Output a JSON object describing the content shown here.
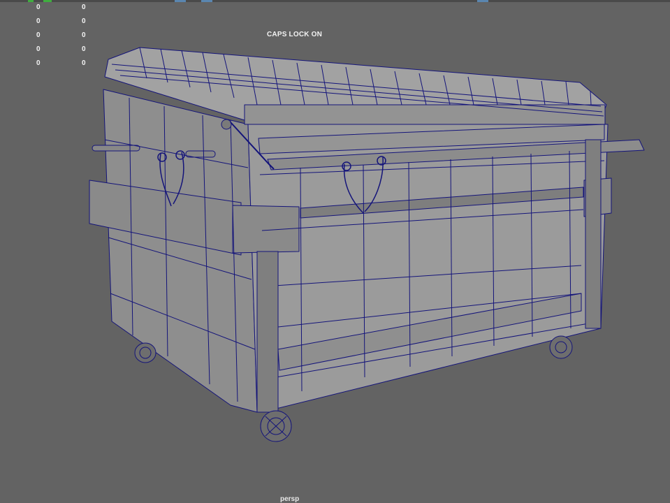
{
  "hud": {
    "rows": [
      {
        "a": "0",
        "b": "0"
      },
      {
        "a": "0",
        "b": "0"
      },
      {
        "a": "0",
        "b": "0"
      },
      {
        "a": "0",
        "b": "0"
      },
      {
        "a": "0",
        "b": "0"
      }
    ]
  },
  "status": {
    "caps_lock": "CAPS LOCK ON"
  },
  "viewport": {
    "camera": "persp"
  },
  "colors": {
    "background": "#636363",
    "wireframe": "#14147a",
    "surface": "#9a9a9a",
    "surface_dark": "#848484"
  },
  "scene": {
    "object": "dumpster wireframe model"
  }
}
